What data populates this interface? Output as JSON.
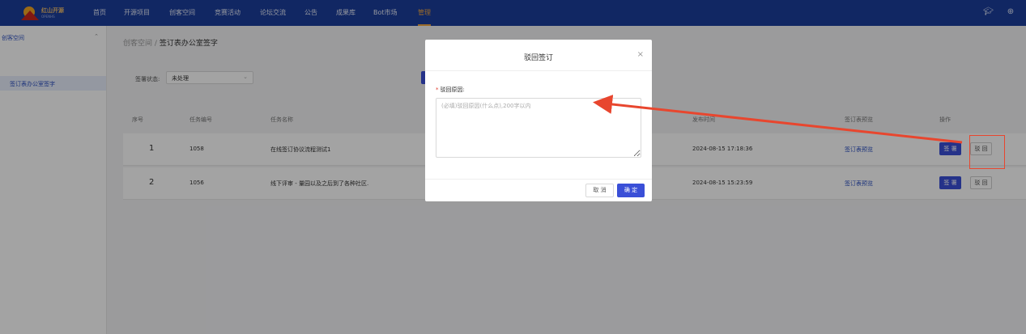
{
  "nav": {
    "logo_title": "红山开源",
    "logo_sub": "OPENHS",
    "items": [
      {
        "label": "首页"
      },
      {
        "label": "开源项目"
      },
      {
        "label": "创客空间"
      },
      {
        "label": "竞赛活动"
      },
      {
        "label": "论坛交流"
      },
      {
        "label": "公告"
      },
      {
        "label": "成果库"
      },
      {
        "label": "Bot市场"
      },
      {
        "label": "管理"
      }
    ],
    "active_index": 8,
    "icons": [
      "graduation-cap-icon",
      "plus-circle-icon"
    ]
  },
  "sidebar": {
    "group_label": "创客空间",
    "items": [
      {
        "label": "签订表办公室签字"
      }
    ]
  },
  "breadcrumb": {
    "root": "创客空间",
    "separator": "/",
    "current": "签订表办公室签字"
  },
  "filter": {
    "label": "签署状态:",
    "value": "未处理"
  },
  "table": {
    "headers": [
      "序号",
      "任务编号",
      "任务名称",
      "发布时间",
      "签订表预览",
      "操作"
    ],
    "rows": [
      {
        "index": "1",
        "task_id": "1058",
        "task_name": "在线签订协议流程测试1",
        "publish_time": "2024-08-15 17:18:36",
        "preview": "签订表预览",
        "sign": "签 署",
        "reject": "驳 回"
      },
      {
        "index": "2",
        "task_id": "1056",
        "task_name": "线下评审 - 量园以及之后到了各种社区.",
        "publish_time": "2024-08-15 15:23:59",
        "preview": "签订表预览",
        "sign": "签 署",
        "reject": "驳 回"
      }
    ]
  },
  "modal": {
    "title": "驳回签订",
    "close_glyph": "×",
    "required_mark": "*",
    "field_label": "驳回原因:",
    "placeholder": "(必填)驳回原因(什么点),200字以内",
    "value": "",
    "cancel_label": "取 消",
    "confirm_label": "确 定"
  },
  "colors": {
    "nav_bg": "#1c3d9c",
    "accent": "#3a4fd7",
    "active_nav": "#f0a742",
    "annotation": "#e8462e"
  }
}
